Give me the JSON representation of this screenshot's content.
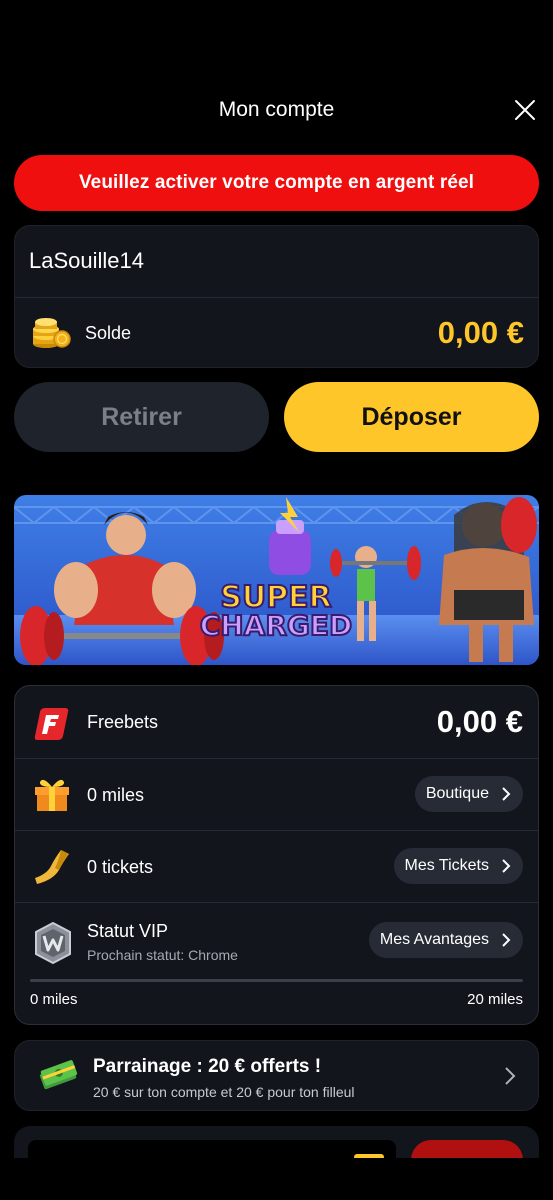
{
  "header": {
    "title": "Mon compte",
    "close_icon": "close-icon"
  },
  "alert": {
    "text": "Veuillez activer votre compte en argent réel",
    "color": "#ef0f0f"
  },
  "account": {
    "username": "LaSouille14",
    "balance_label": "Solde",
    "balance_value": "0,00 €",
    "balance_icon": "coins-icon"
  },
  "actions": {
    "withdraw_label": "Retirer",
    "deposit_label": "Déposer"
  },
  "banner": {
    "text_line1": "SUPER",
    "text_line2": "CHARGED"
  },
  "rewards": {
    "freebets": {
      "label": "Freebets",
      "value": "0,00 €",
      "icon": "freebets-logo-icon"
    },
    "miles": {
      "label": "0 miles",
      "button": "Boutique",
      "icon": "gift-box-icon"
    },
    "tickets": {
      "label": "0 tickets",
      "button": "Mes Tickets",
      "icon": "ticket-icon"
    },
    "vip": {
      "label": "Statut VIP",
      "sub": "Prochain statut: Chrome",
      "button": "Mes Avantages",
      "icon": "vip-badge-icon",
      "progress_fraction": 0,
      "min_label": "0 miles",
      "max_label": "20 miles"
    }
  },
  "referral": {
    "title": "Parrainage : 20 € offerts !",
    "subtitle": "20 € sur ton compte et 20 € pour ton filleul",
    "icon": "money-stack-icon"
  },
  "colors": {
    "accent": "#ffc629",
    "card": "#12151c",
    "danger": "#ef0f0f",
    "pill": "#262b36"
  }
}
